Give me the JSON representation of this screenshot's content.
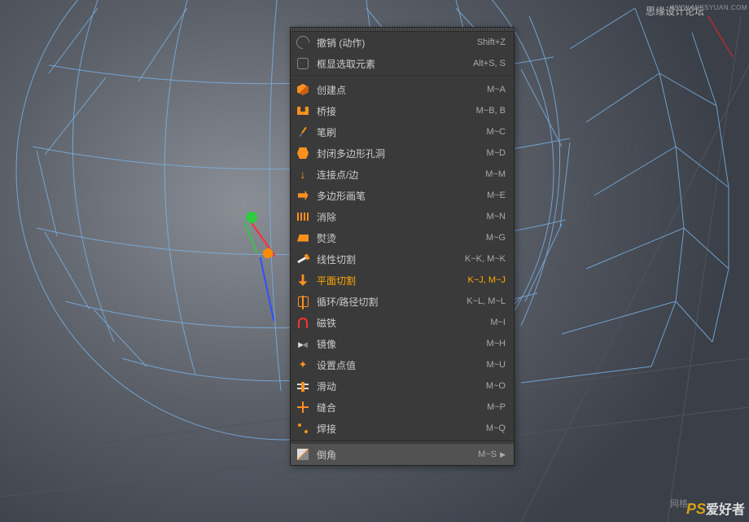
{
  "watermarks": {
    "topLeft": "思缘设计论坛",
    "topLeftUrl": "WWW.MISSYUAN.COM",
    "bottomLeft": "网格",
    "bottomRightPS": "PS",
    "bottomRightText": "爱好者"
  },
  "menu": {
    "groups": [
      [
        {
          "icon": "undo",
          "label": "撤销 (动作)",
          "shortcut": "Shift+Z",
          "name": "undo-action"
        },
        {
          "icon": "frame",
          "label": "框显选取元素",
          "shortcut": "Alt+S, S",
          "name": "frame-selected"
        }
      ],
      [
        {
          "icon": "cube",
          "label": "创建点",
          "shortcut": "M~A",
          "name": "create-point"
        },
        {
          "icon": "bridge",
          "label": "桥接",
          "shortcut": "M~B, B",
          "name": "bridge"
        },
        {
          "icon": "brush",
          "label": "笔刷",
          "shortcut": "M~C",
          "name": "brush"
        },
        {
          "icon": "close",
          "label": "封闭多边形孔洞",
          "shortcut": "M~D",
          "name": "close-polygon-hole"
        },
        {
          "icon": "connect",
          "label": "连接点/边",
          "shortcut": "M~M",
          "name": "connect-points-edges"
        },
        {
          "icon": "polypen",
          "label": "多边形画笔",
          "shortcut": "M~E",
          "name": "polygon-pen"
        },
        {
          "icon": "dissolve",
          "label": "消除",
          "shortcut": "M~N",
          "name": "dissolve"
        },
        {
          "icon": "iron",
          "label": "熨烫",
          "shortcut": "M~G",
          "name": "iron"
        },
        {
          "icon": "knife",
          "label": "线性切割",
          "shortcut": "K~K, M~K",
          "name": "line-cut"
        },
        {
          "icon": "plane",
          "label": "平面切割",
          "shortcut": "K~J, M~J",
          "name": "plane-cut",
          "highlighted": true
        },
        {
          "icon": "loop",
          "label": "循环/路径切割",
          "shortcut": "K~L, M~L",
          "name": "loop-path-cut"
        },
        {
          "icon": "magnet",
          "label": "磁铁",
          "shortcut": "M~I",
          "name": "magnet"
        },
        {
          "icon": "mirror",
          "label": "镜像",
          "shortcut": "M~H",
          "name": "mirror"
        },
        {
          "icon": "setpoint",
          "label": "设置点值",
          "shortcut": "M~U",
          "name": "set-point-value"
        },
        {
          "icon": "slide",
          "label": "滑动",
          "shortcut": "M~O",
          "name": "slide"
        },
        {
          "icon": "spin",
          "label": "缝合",
          "shortcut": "M~P",
          "name": "spin-edge"
        },
        {
          "icon": "weld",
          "label": "焊接",
          "shortcut": "M~Q",
          "name": "weld"
        }
      ],
      [
        {
          "icon": "bevel",
          "label": "倒角",
          "shortcut": "M~S",
          "name": "bevel",
          "hovered": true,
          "submenu": true
        }
      ]
    ]
  }
}
